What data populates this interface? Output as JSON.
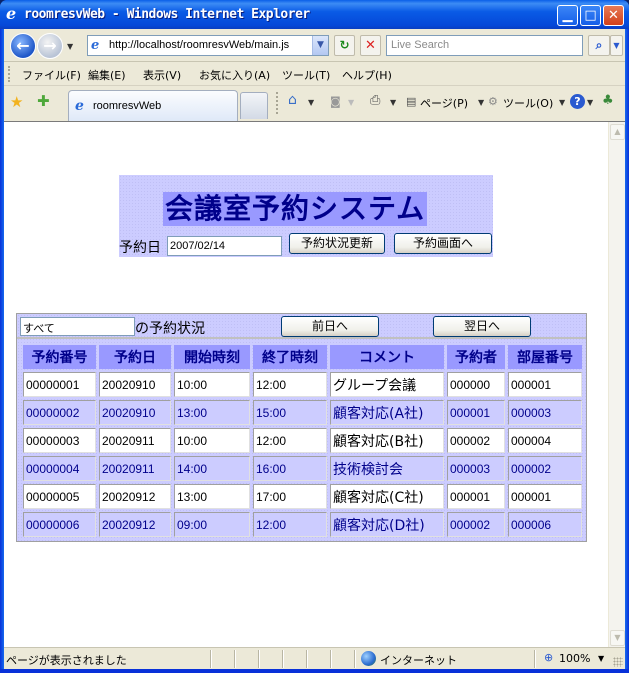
{
  "window": {
    "title": "roomresvWeb - Windows Internet Explorer",
    "minimize_glyph": "▁",
    "maximize_glyph": "□",
    "close_glyph": "✕"
  },
  "addressbar": {
    "back_glyph": "←",
    "forward_glyph": "→",
    "url": "http://localhost/roomresvWeb/main.js",
    "refresh_glyph": "↻",
    "stop_glyph": "✕",
    "search_placeholder": "Live Search",
    "search_glyph": "⌕"
  },
  "menubar": {
    "items": [
      "ファイル(F)",
      "編集(E)",
      "表示(V)",
      "お気に入り(A)",
      "ツール(T)",
      "ヘルプ(H)"
    ]
  },
  "tabbar": {
    "tab_label": "roomresvWeb",
    "favorites_glyph": "★",
    "add_favorites_glyph": "✚",
    "home_glyph": "⌂",
    "feeds_glyph": "◙",
    "print_glyph": "⎙",
    "page_label": "ページ(P)",
    "tools_label": "ツール(O)",
    "help_glyph": "?",
    "research_glyph": "♣"
  },
  "page": {
    "heading": "会議室予約システム",
    "date_label": "予約日",
    "date_value": "2007/02/14",
    "update_button": "予約状況更新",
    "reserve_button": "予約画面へ",
    "scope_value": "すべて",
    "scope_suffix": "の予約状況",
    "prev_day_button": "前日へ",
    "next_day_button": "翌日へ",
    "columns": [
      "予約番号",
      "予約日",
      "開始時刻",
      "終了時刻",
      "コメント",
      "予約者",
      "部屋番号"
    ],
    "rows": [
      [
        "00000001",
        "20020910",
        "10:00",
        "12:00",
        "グループ会議",
        "000000",
        "000001"
      ],
      [
        "00000002",
        "20020910",
        "13:00",
        "15:00",
        "顧客対応(A社)",
        "000001",
        "000003"
      ],
      [
        "00000003",
        "20020911",
        "10:00",
        "12:00",
        "顧客対応(B社)",
        "000002",
        "000004"
      ],
      [
        "00000004",
        "20020911",
        "14:00",
        "16:00",
        "技術検討会",
        "000003",
        "000002"
      ],
      [
        "00000005",
        "20020912",
        "13:00",
        "17:00",
        "顧客対応(C社)",
        "000001",
        "000001"
      ],
      [
        "00000006",
        "20020912",
        "09:00",
        "12:00",
        "顧客対応(D社)",
        "000002",
        "000006"
      ]
    ]
  },
  "statusbar": {
    "message": "ページが表示されました",
    "zone": "インターネット",
    "zoom": "100%"
  },
  "colors": {
    "header_bg": "#ccccff",
    "heading_bg": "#9999ff",
    "heading_text": "#00008b"
  }
}
